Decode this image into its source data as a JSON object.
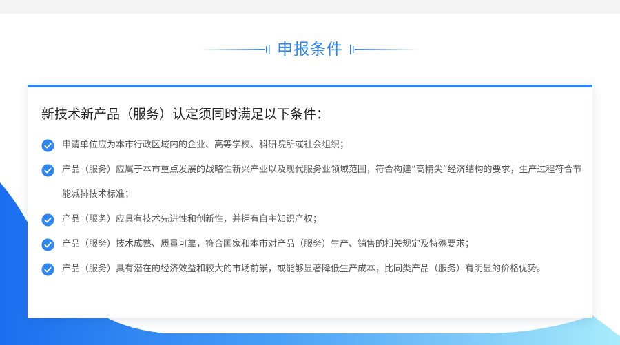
{
  "section": {
    "title": "申报条件"
  },
  "card": {
    "title": "新技术新产品（服务）认定须同时满足以下条件：",
    "conditions": [
      "申请单位应为本市行政区域内的企业、高等学校、科研院所或社会组织；",
      "产品（服务）应属于本市重点发展的战略性新兴产业以及现代服务业领域范围，符合构建“高精尖”经济结构的要求，生产过程符合节能减排技术标准；",
      "产品（服务）应具有技术先进性和创新性，并拥有自主知识产权；",
      "产品（服务）技术成熟、质量可靠，符合国家和本市对产品（服务）生产、销售的相关规定及特殊要求；",
      "产品（服务）具有潜在的经济效益和较大的市场前景，或能够显著降低生产成本，比同类产品（服务）有明显的价格优势。"
    ]
  },
  "colors": {
    "accent": "#2f86f0",
    "gradient_start": "#1a6ff0",
    "gradient_end": "#a8ecfb"
  },
  "icons": {
    "check": "check-circle-icon"
  }
}
